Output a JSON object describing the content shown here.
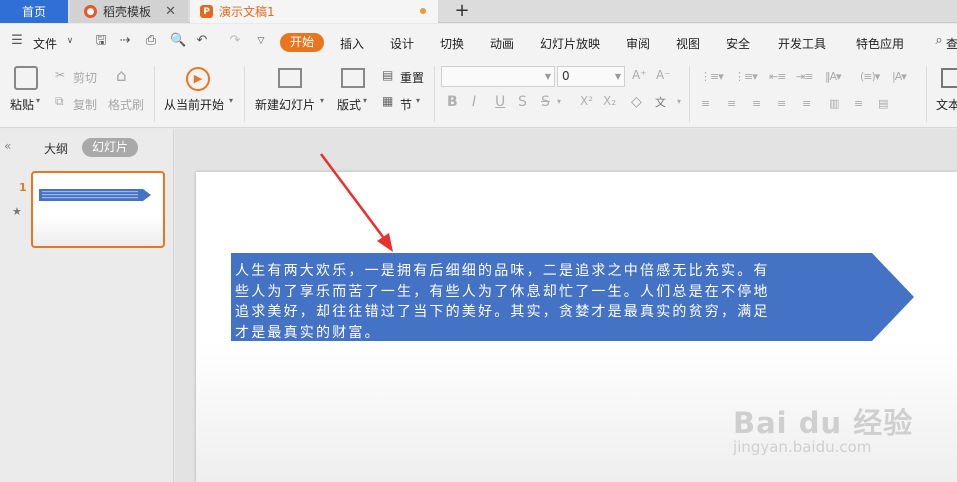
{
  "tabs": {
    "home": "首页",
    "template": "稻壳模板",
    "document": "演示文稿1",
    "new_tab": "+"
  },
  "menu": {
    "file": "文件",
    "items": [
      "开始",
      "插入",
      "设计",
      "切换",
      "动画",
      "幻灯片放映",
      "审阅",
      "视图",
      "安全",
      "开发工具",
      "特色应用"
    ],
    "search": "查"
  },
  "ribbon": {
    "paste": "粘贴",
    "cut": "剪切",
    "copy": "复制",
    "format_painter": "格式刷",
    "from_current": "从当前开始",
    "new_slide": "新建幻灯片",
    "layout": "版式",
    "reset": "重置",
    "section": "节",
    "font_name": "",
    "font_size": "0",
    "text_box": "文本"
  },
  "panel": {
    "outline_tab": "大纲",
    "slides_tab": "幻灯片",
    "slide_number": "1"
  },
  "slide": {
    "text": "人生有两大欢乐，一是拥有后细细的品味，二是追求之中倍感无比充实。有\n些人为了享乐而苦了一生，有些人为了休息却忙了一生。人们总是在不停地\n追求美好，却往往错过了当下的美好。其实，贪婪才是最真实的贫穷，满足\n才是最真实的财富。",
    "shape_color": "#4472c4"
  },
  "watermark": {
    "brand": "Bai du 经验",
    "url": "jingyan.baidu.com"
  },
  "colors": {
    "accent": "#e8761e",
    "home_tab": "#2f6fd6",
    "annotation_arrow": "#e8312f"
  }
}
